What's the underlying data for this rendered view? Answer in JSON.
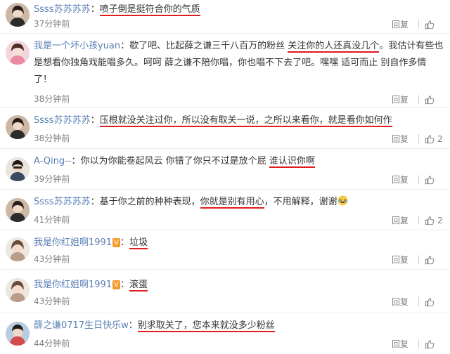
{
  "comments": [
    {
      "user": "Ssss苏苏苏苏",
      "parts": [
        {
          "t": "喷子倒是挺符合你的气质",
          "hl": true
        }
      ],
      "time": "37分钟前",
      "reply": "回复",
      "likes": ""
    },
    {
      "user": "我是一个坏小孩yuan",
      "parts": [
        {
          "t": "歇了吧、比起薛之谦三千八百万的粉丝 ",
          "hl": false
        },
        {
          "t": "关注你的人还真没几个",
          "hl": true
        },
        {
          "t": "。我估计有些也是想看你独角戏能唱多久。呵呵 薛之谦不陪你唱，你也唱不下去了吧。嘿嘿 适可而止 别自作多情了！",
          "hl": false
        }
      ],
      "time": "38分钟前",
      "reply": "回复",
      "likes": ""
    },
    {
      "user": "Ssss苏苏苏苏",
      "parts": [
        {
          "t": "压根就没关注过你，所以没有取关一说，之所以来看你，就是看你如何作",
          "hl": true
        }
      ],
      "time": "38分钟前",
      "reply": "回复",
      "likes": "2"
    },
    {
      "user": "A-Qing--",
      "parts": [
        {
          "t": "你以为你能卷起风云  你错了你只不过是放个屁  ",
          "hl": false
        },
        {
          "t": "谁认识你啊",
          "hl": true
        }
      ],
      "time": "39分钟前",
      "reply": "回复",
      "likes": ""
    },
    {
      "user": "Ssss苏苏苏苏",
      "parts": [
        {
          "t": "基于你之前的种种表现，",
          "hl": false
        },
        {
          "t": "你就是别有用心",
          "hl": true
        },
        {
          "t": "，不用解释，谢谢",
          "hl": false
        }
      ],
      "emoji": "laugh-cry-emoji",
      "time": "41分钟前",
      "reply": "回复",
      "likes": "2"
    },
    {
      "user": "我是你红姐啊1991",
      "badge": "V",
      "parts": [
        {
          "t": "垃圾",
          "hl": true
        }
      ],
      "time": "43分钟前",
      "reply": "回复",
      "likes": ""
    },
    {
      "user": "我是你红姐啊1991",
      "badge": "V",
      "parts": [
        {
          "t": "滚蛋",
          "hl": true
        }
      ],
      "time": "43分钟前",
      "reply": "回复",
      "likes": ""
    },
    {
      "user": "薛之谦0717生日快乐w",
      "parts": [
        {
          "t": "别求取关了，您本来就没多少粉丝",
          "hl": true
        }
      ],
      "time": "44分钟前",
      "reply": "回复",
      "likes": ""
    }
  ],
  "colors": {
    "username": "#5a7fb5",
    "highlight": "#e01c1c",
    "muted": "#808080"
  },
  "icons": {
    "like": "thumbs-up-icon",
    "avatar": "avatar"
  }
}
